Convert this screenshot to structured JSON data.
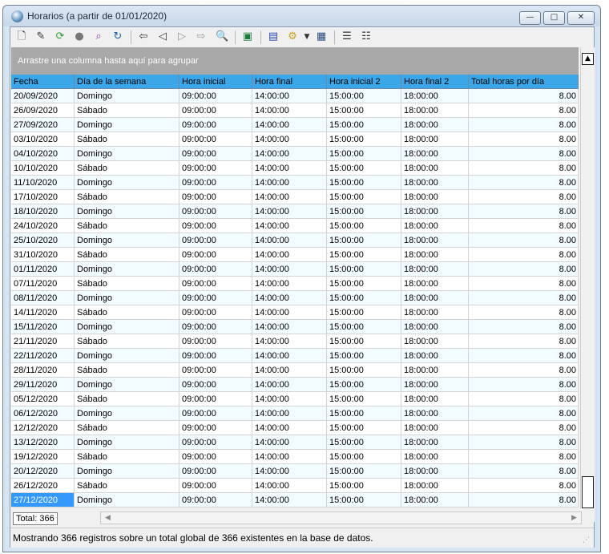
{
  "window": {
    "title": "Horarios (a partir de 01/01/2020)",
    "controls": {
      "minimize": "—",
      "maximize": "□",
      "close": "✕"
    }
  },
  "toolbar": {
    "icons": [
      "new-icon",
      "edit-icon",
      "refresh-data-icon",
      "user-icon",
      "search-icon",
      "reload-icon",
      "first-icon",
      "prev-icon",
      "next-icon",
      "last-icon",
      "print-preview-icon",
      "export-excel-icon",
      "notes-icon",
      "filter-icon",
      "dropdown-icon",
      "report-icon",
      "columns-icon",
      "fields-icon"
    ]
  },
  "grid": {
    "group_hint": "Arrastre una columna hasta aquí para agrupar",
    "columns": [
      "Fecha",
      "Día de la semana",
      "Hora inicial",
      "Hora final",
      "Hora inicial 2",
      "Hora final 2",
      "Total horas por día"
    ],
    "rows": [
      [
        "20/09/2020",
        "Domingo",
        "09:00:00",
        "14:00:00",
        "15:00:00",
        "18:00:00",
        "8.00"
      ],
      [
        "26/09/2020",
        "Sábado",
        "09:00:00",
        "14:00:00",
        "15:00:00",
        "18:00:00",
        "8.00"
      ],
      [
        "27/09/2020",
        "Domingo",
        "09:00:00",
        "14:00:00",
        "15:00:00",
        "18:00:00",
        "8.00"
      ],
      [
        "03/10/2020",
        "Sábado",
        "09:00:00",
        "14:00:00",
        "15:00:00",
        "18:00:00",
        "8.00"
      ],
      [
        "04/10/2020",
        "Domingo",
        "09:00:00",
        "14:00:00",
        "15:00:00",
        "18:00:00",
        "8.00"
      ],
      [
        "10/10/2020",
        "Sábado",
        "09:00:00",
        "14:00:00",
        "15:00:00",
        "18:00:00",
        "8.00"
      ],
      [
        "11/10/2020",
        "Domingo",
        "09:00:00",
        "14:00:00",
        "15:00:00",
        "18:00:00",
        "8.00"
      ],
      [
        "17/10/2020",
        "Sábado",
        "09:00:00",
        "14:00:00",
        "15:00:00",
        "18:00:00",
        "8.00"
      ],
      [
        "18/10/2020",
        "Domingo",
        "09:00:00",
        "14:00:00",
        "15:00:00",
        "18:00:00",
        "8.00"
      ],
      [
        "24/10/2020",
        "Sábado",
        "09:00:00",
        "14:00:00",
        "15:00:00",
        "18:00:00",
        "8.00"
      ],
      [
        "25/10/2020",
        "Domingo",
        "09:00:00",
        "14:00:00",
        "15:00:00",
        "18:00:00",
        "8.00"
      ],
      [
        "31/10/2020",
        "Sábado",
        "09:00:00",
        "14:00:00",
        "15:00:00",
        "18:00:00",
        "8.00"
      ],
      [
        "01/11/2020",
        "Domingo",
        "09:00:00",
        "14:00:00",
        "15:00:00",
        "18:00:00",
        "8.00"
      ],
      [
        "07/11/2020",
        "Sábado",
        "09:00:00",
        "14:00:00",
        "15:00:00",
        "18:00:00",
        "8.00"
      ],
      [
        "08/11/2020",
        "Domingo",
        "09:00:00",
        "14:00:00",
        "15:00:00",
        "18:00:00",
        "8.00"
      ],
      [
        "14/11/2020",
        "Sábado",
        "09:00:00",
        "14:00:00",
        "15:00:00",
        "18:00:00",
        "8.00"
      ],
      [
        "15/11/2020",
        "Domingo",
        "09:00:00",
        "14:00:00",
        "15:00:00",
        "18:00:00",
        "8.00"
      ],
      [
        "21/11/2020",
        "Sábado",
        "09:00:00",
        "14:00:00",
        "15:00:00",
        "18:00:00",
        "8.00"
      ],
      [
        "22/11/2020",
        "Domingo",
        "09:00:00",
        "14:00:00",
        "15:00:00",
        "18:00:00",
        "8.00"
      ],
      [
        "28/11/2020",
        "Sábado",
        "09:00:00",
        "14:00:00",
        "15:00:00",
        "18:00:00",
        "8.00"
      ],
      [
        "29/11/2020",
        "Domingo",
        "09:00:00",
        "14:00:00",
        "15:00:00",
        "18:00:00",
        "8.00"
      ],
      [
        "05/12/2020",
        "Sábado",
        "09:00:00",
        "14:00:00",
        "15:00:00",
        "18:00:00",
        "8.00"
      ],
      [
        "06/12/2020",
        "Domingo",
        "09:00:00",
        "14:00:00",
        "15:00:00",
        "18:00:00",
        "8.00"
      ],
      [
        "12/12/2020",
        "Sábado",
        "09:00:00",
        "14:00:00",
        "15:00:00",
        "18:00:00",
        "8.00"
      ],
      [
        "13/12/2020",
        "Domingo",
        "09:00:00",
        "14:00:00",
        "15:00:00",
        "18:00:00",
        "8.00"
      ],
      [
        "19/12/2020",
        "Sábado",
        "09:00:00",
        "14:00:00",
        "15:00:00",
        "18:00:00",
        "8.00"
      ],
      [
        "20/12/2020",
        "Domingo",
        "09:00:00",
        "14:00:00",
        "15:00:00",
        "18:00:00",
        "8.00"
      ],
      [
        "26/12/2020",
        "Sábado",
        "09:00:00",
        "14:00:00",
        "15:00:00",
        "18:00:00",
        "8.00"
      ],
      [
        "27/12/2020",
        "Domingo",
        "09:00:00",
        "14:00:00",
        "15:00:00",
        "18:00:00",
        "8.00"
      ]
    ],
    "selected_row": 28
  },
  "footer": {
    "total_label": "Total: 366"
  },
  "status": {
    "text": "Mostrando 366 registros sobre un total global de 366 existentes en la base de datos."
  },
  "colors": {
    "header": "#3ba7e8",
    "selected": "#3399ff",
    "group_bar": "#a8a8a8"
  }
}
